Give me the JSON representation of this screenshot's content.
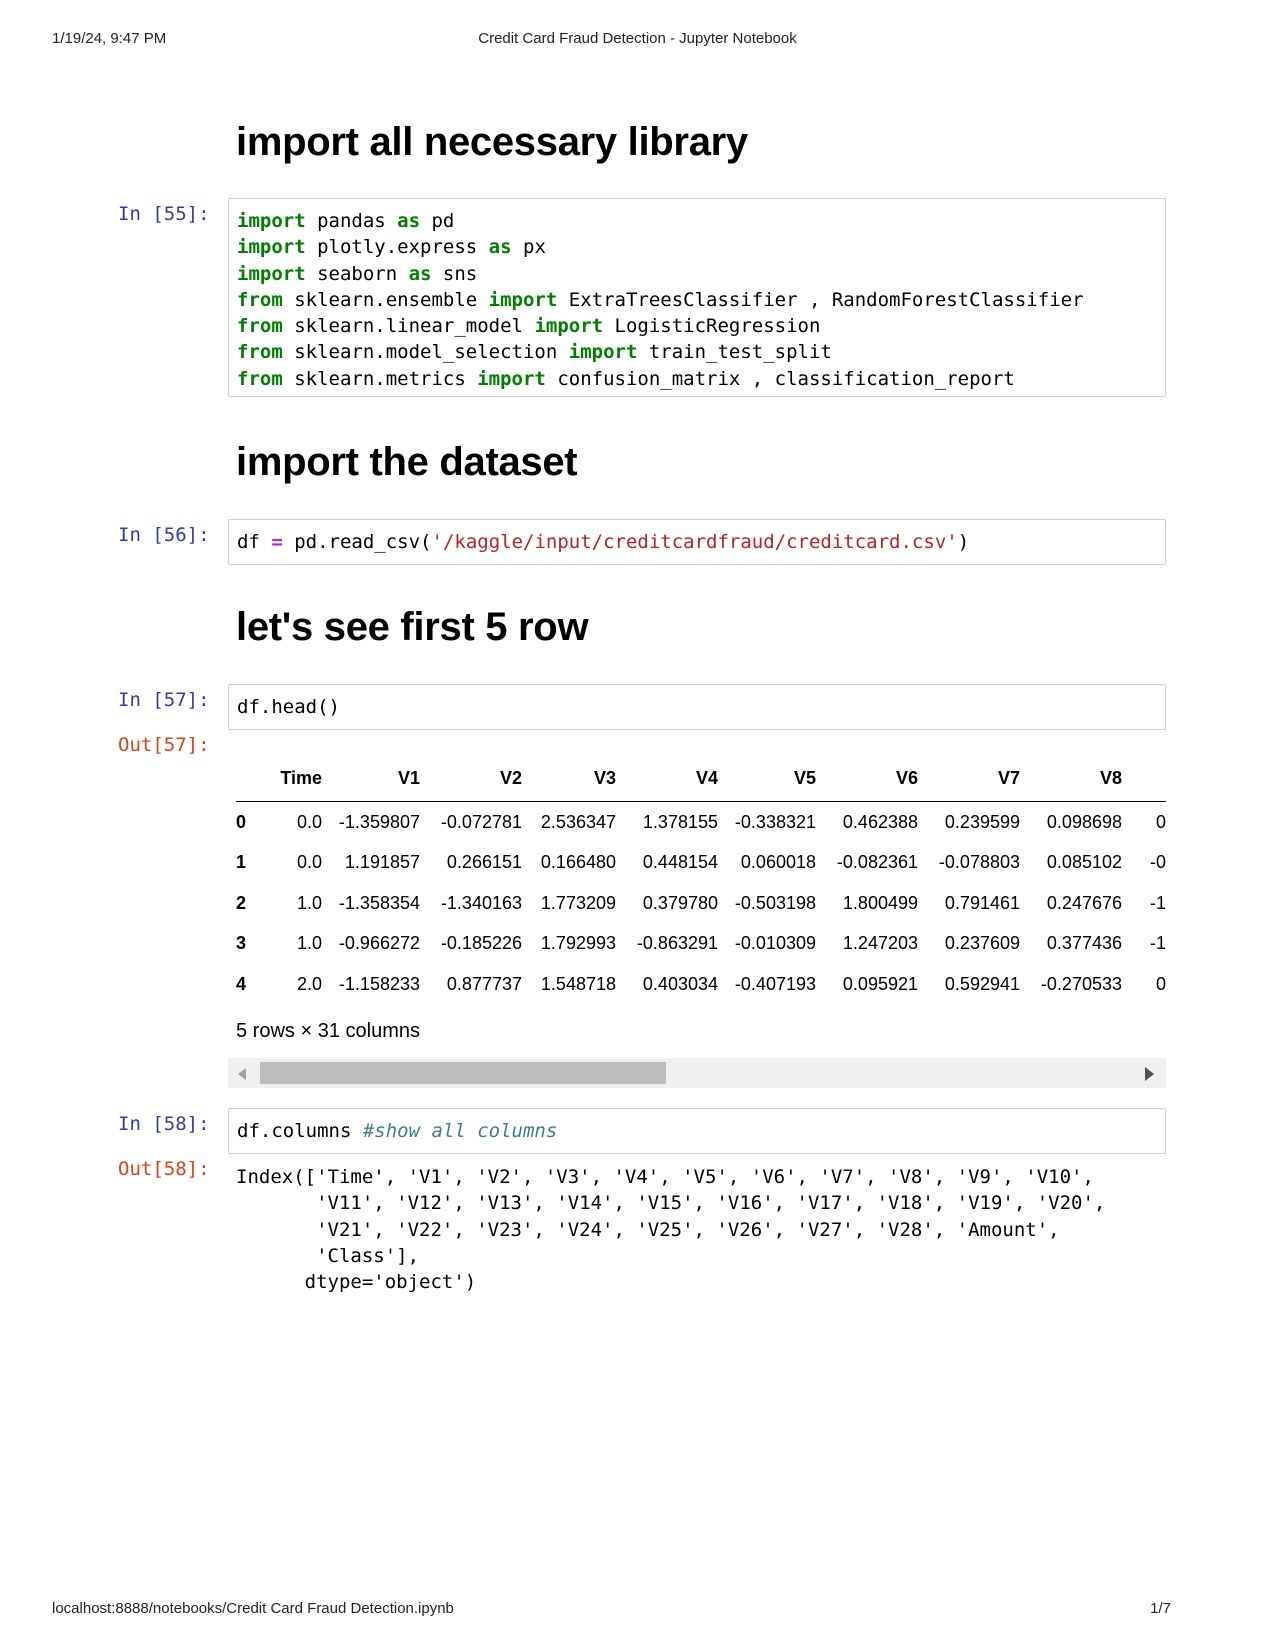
{
  "print_header": {
    "datetime": "1/19/24, 9:47 PM",
    "title": "Credit Card Fraud Detection - Jupyter Notebook"
  },
  "print_footer": {
    "url": "localhost:8888/notebooks/Credit Card Fraud Detection.ipynb",
    "page": "1/7"
  },
  "cells": {
    "heading1": "import all necessary library",
    "cell55": {
      "prompt": "In [55]:",
      "lines": [
        {
          "kw1": "import",
          "mod": " pandas ",
          "kw2": "as",
          "alias": " pd"
        },
        {
          "kw1": "import",
          "mod": " plotly.express ",
          "kw2": "as",
          "alias": " px"
        },
        {
          "kw1": "import",
          "mod": " seaborn ",
          "kw2": "as",
          "alias": " sns"
        },
        {
          "kw1": "from",
          "mod": " sklearn.ensemble ",
          "kw2": "import",
          "alias": " ExtraTreesClassifier , RandomForestClassifier"
        },
        {
          "kw1": "from",
          "mod": " sklearn.linear_model ",
          "kw2": "import",
          "alias": " LogisticRegression"
        },
        {
          "kw1": "from",
          "mod": " sklearn.model_selection ",
          "kw2": "import",
          "alias": " train_test_split"
        },
        {
          "kw1": "from",
          "mod": " sklearn.metrics ",
          "kw2": "import",
          "alias": " confusion_matrix , classification_report"
        }
      ]
    },
    "heading2": "import the dataset",
    "cell56": {
      "prompt": "In [56]:",
      "code_pre": "df ",
      "code_op": "=",
      "code_mid": " pd.read_csv(",
      "code_str": "'/kaggle/input/creditcardfraud/creditcard.csv'",
      "code_post": ")"
    },
    "heading3": "let's see first 5 row",
    "cell57": {
      "prompt": "In [57]:",
      "code": "df.head()",
      "out_prompt": "Out[57]:",
      "columns": [
        "",
        "Time",
        "V1",
        "V2",
        "V3",
        "V4",
        "V5",
        "V6",
        "V7",
        "V8",
        ""
      ],
      "rows": [
        [
          "0",
          "0.0",
          "-1.359807",
          "-0.072781",
          "2.536347",
          "1.378155",
          "-0.338321",
          "0.462388",
          "0.239599",
          "0.098698",
          "0"
        ],
        [
          "1",
          "0.0",
          "1.191857",
          "0.266151",
          "0.166480",
          "0.448154",
          "0.060018",
          "-0.082361",
          "-0.078803",
          "0.085102",
          "-0"
        ],
        [
          "2",
          "1.0",
          "-1.358354",
          "-1.340163",
          "1.773209",
          "0.379780",
          "-0.503198",
          "1.800499",
          "0.791461",
          "0.247676",
          "-1"
        ],
        [
          "3",
          "1.0",
          "-0.966272",
          "-0.185226",
          "1.792993",
          "-0.863291",
          "-0.010309",
          "1.247203",
          "0.237609",
          "0.377436",
          "-1"
        ],
        [
          "4",
          "2.0",
          "-1.158233",
          "0.877737",
          "1.548718",
          "0.403034",
          "-0.407193",
          "0.095921",
          "0.592941",
          "-0.270533",
          "0"
        ]
      ],
      "shape_note": "5 rows × 31 columns"
    },
    "cell58": {
      "prompt": "In [58]:",
      "code": "df.columns ",
      "comment": "#show all columns",
      "out_prompt": "Out[58]:",
      "output_lines": [
        "Index(['Time', 'V1', 'V2', 'V3', 'V4', 'V5', 'V6', 'V7', 'V8', 'V9', 'V10',",
        "       'V11', 'V12', 'V13', 'V14', 'V15', 'V16', 'V17', 'V18', 'V19', 'V20',",
        "       'V21', 'V22', 'V23', 'V24', 'V25', 'V26', 'V27', 'V28', 'Amount',",
        "       'Class'],",
        "      dtype='object')"
      ]
    }
  }
}
